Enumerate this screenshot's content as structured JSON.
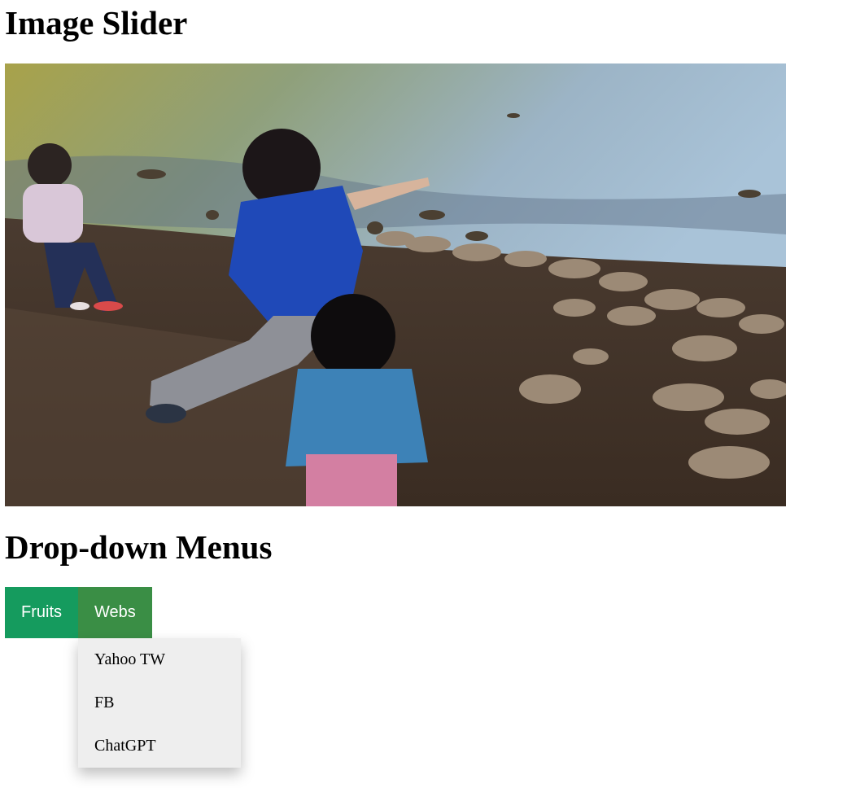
{
  "headings": {
    "slider_title": "Image Slider",
    "dropdown_title": "Drop-down Menus"
  },
  "slider": {
    "image_subject": "children-feeding-ducks-at-lake"
  },
  "menu": {
    "buttons": [
      {
        "label": "Fruits",
        "color": "#159b5e"
      },
      {
        "label": "Webs",
        "color": "#3a8e45"
      }
    ],
    "open_menu": "Webs",
    "dropdown_items": [
      "Yahoo TW",
      "FB",
      "ChatGPT"
    ]
  }
}
